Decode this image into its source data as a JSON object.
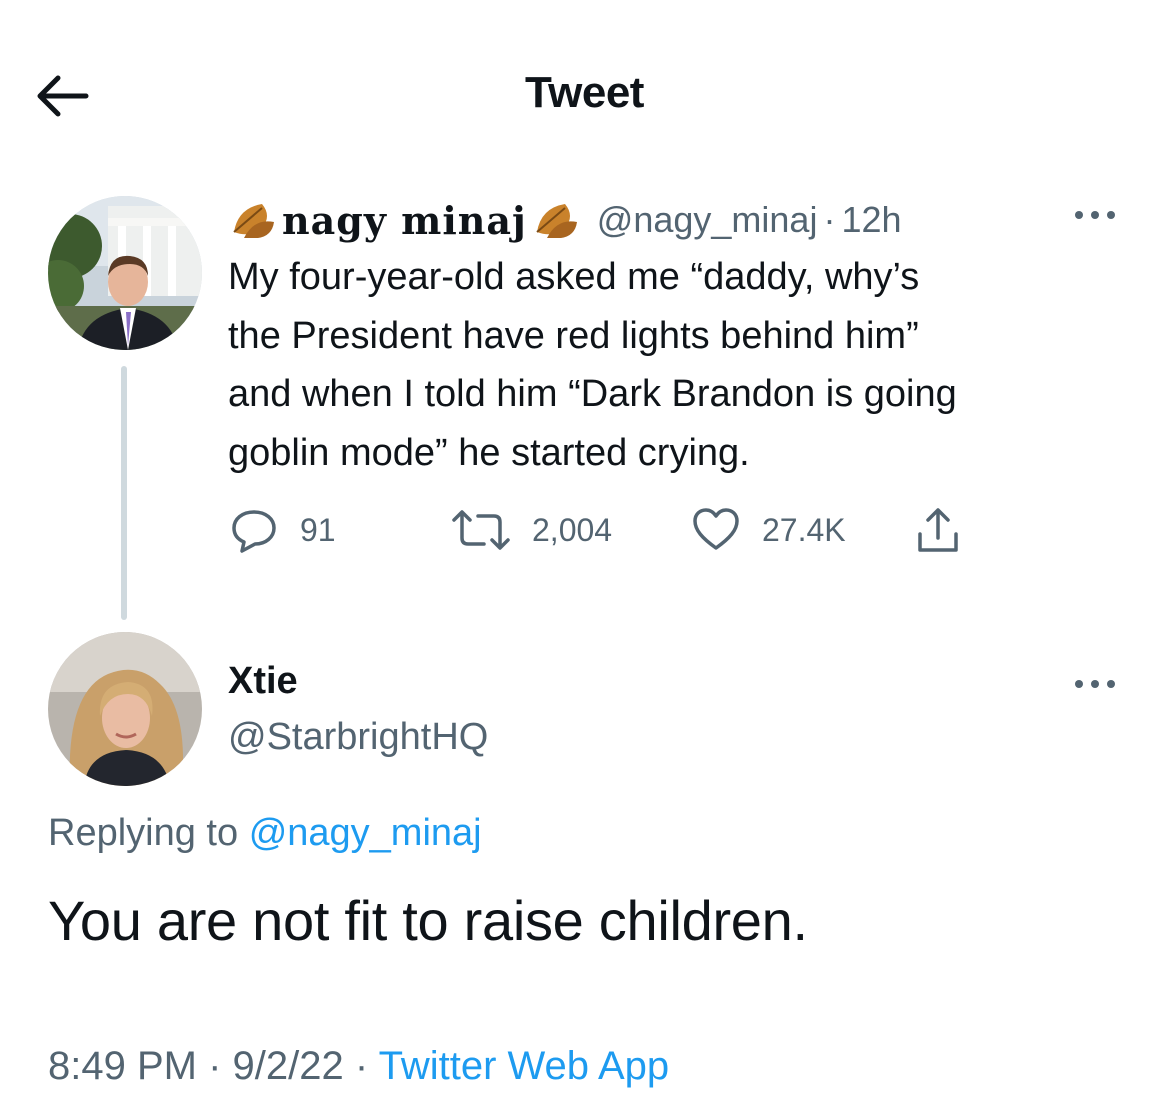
{
  "header": {
    "title": "Tweet",
    "back_icon": "arrow-left-icon"
  },
  "parent_tweet": {
    "display_name": "nagy minaj",
    "display_name_emoji": "fallen-leaf-icon",
    "handle": "@nagy_minaj",
    "separator": "·",
    "time": "12h",
    "text_lines": [
      "My four-year-old asked me “daddy, why’s",
      "the President have red lights behind him”",
      "and when I told him “Dark Brandon is going",
      "goblin mode” he started crying."
    ],
    "replies": "91",
    "retweets": "2,004",
    "likes": "27.4K"
  },
  "reply_tweet": {
    "display_name": "Xtie",
    "handle": "@StarbrightHQ",
    "replying_prefix": "Replying to",
    "replying_to": "@nagy_minaj",
    "text": "You are not fit to raise children.",
    "time": "8:49 PM",
    "separator": "·",
    "date": "9/2/22",
    "separator2": "·",
    "source": "Twitter Web App"
  },
  "colors": {
    "text": "#0f1419",
    "secondary": "#536471",
    "accent": "#1d9bf0",
    "thread": "#cfd9de"
  }
}
